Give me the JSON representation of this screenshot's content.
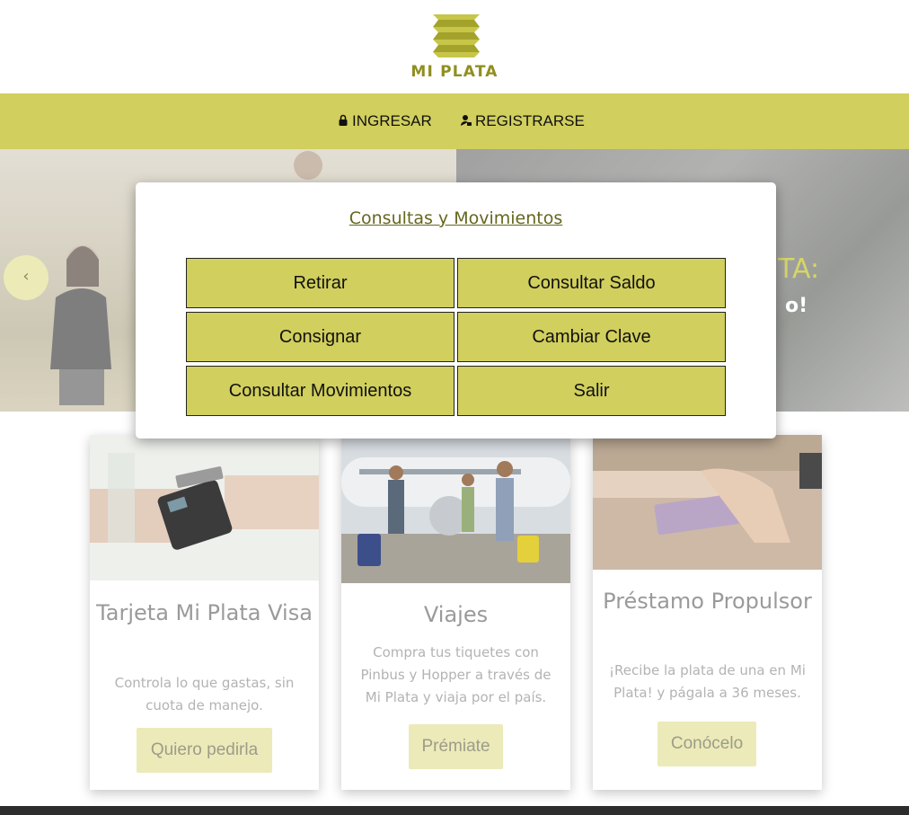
{
  "brand": {
    "name": "MI PLATA",
    "color": "#8f8f1f"
  },
  "nav": {
    "ingresar": "INGRESAR",
    "registrarse": "REGISTRARSE",
    "bar_color": "#d1cf5d"
  },
  "hero": {
    "text_1": "TA:",
    "text_2": "o!",
    "prev_glyph": "‹"
  },
  "modal": {
    "title": "Consultas y Movimientos",
    "buttons": {
      "retirar": "Retirar",
      "consultar_saldo": "Consultar Saldo",
      "consignar": "Consignar",
      "cambiar_clave": "Cambiar Clave",
      "consultar_movimientos": "Consultar Movimientos",
      "salir": "Salir"
    }
  },
  "cards": [
    {
      "title": "Tarjeta Mi Plata Visa",
      "desc": "Controla lo que gastas, sin cuota de manejo.",
      "button": "Quiero pedirla"
    },
    {
      "title": "Viajes",
      "desc": "Compra tus tiquetes con Pinbus y Hopper a través de Mi Plata y viaja por el país.",
      "button": "Prémiate"
    },
    {
      "title": "Préstamo Propulsor",
      "desc": "¡Recibe la plata de una en Mi Plata! y págala a 36 meses.",
      "button": "Conócelo"
    }
  ]
}
